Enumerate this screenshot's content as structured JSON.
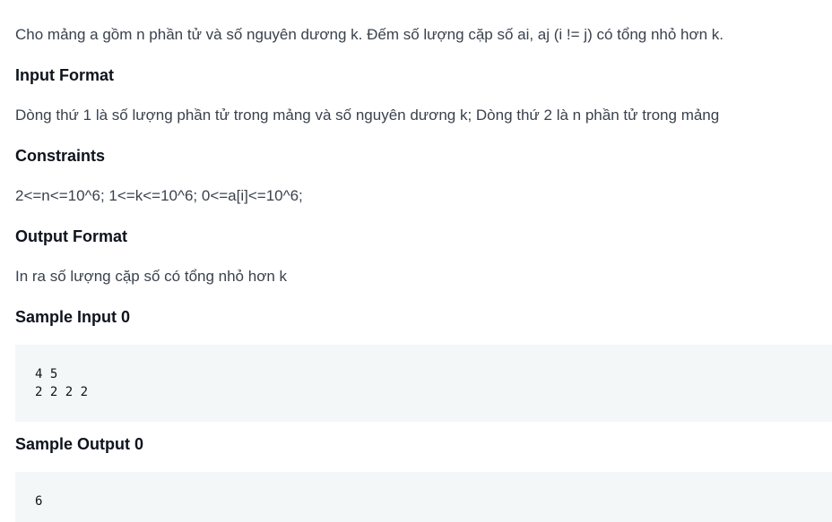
{
  "problem": {
    "statement": "Cho mảng a gồm n phần tử và số nguyên dương k. Đếm số lượng cặp số ai, aj (i != j) có tổng nhỏ hơn k.",
    "input_format": {
      "heading": "Input Format",
      "text": "Dòng thứ 1 là số lượng phần tử trong mảng và số nguyên dương k; Dòng thứ 2 là n phần tử trong mảng"
    },
    "constraints": {
      "heading": "Constraints",
      "text": "2<=n<=10^6; 1<=k<=10^6; 0<=a[i]<=10^6;"
    },
    "output_format": {
      "heading": "Output Format",
      "text": "In ra số lượng cặp số có tổng nhỏ hơn k"
    },
    "sample_input": {
      "heading": "Sample Input 0",
      "code": "4 5\n2 2 2 2"
    },
    "sample_output": {
      "heading": "Sample Output 0",
      "code": "6"
    }
  }
}
